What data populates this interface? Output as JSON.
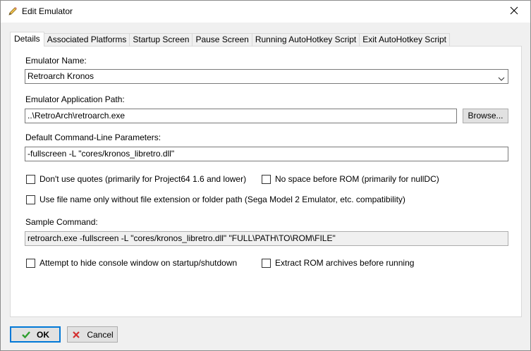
{
  "window": {
    "title": "Edit Emulator",
    "title_icon": "pencil-icon",
    "close_icon": "close-icon"
  },
  "tabs": [
    {
      "label": "Details",
      "active": true
    },
    {
      "label": "Associated Platforms",
      "active": false
    },
    {
      "label": "Startup Screen",
      "active": false
    },
    {
      "label": "Pause Screen",
      "active": false
    },
    {
      "label": "Running AutoHotkey Script",
      "active": false
    },
    {
      "label": "Exit AutoHotkey Script",
      "active": false
    }
  ],
  "details": {
    "emulator_name_label": "Emulator Name:",
    "emulator_name_value": "Retroarch Kronos",
    "app_path_label": "Emulator Application Path:",
    "app_path_value": "..\\RetroArch\\retroarch.exe",
    "browse_label": "Browse...",
    "params_label": "Default Command-Line Parameters:",
    "params_value": "-fullscreen -L  \"cores/kronos_libretro.dll\"",
    "chk_no_quotes": {
      "label": "Don't use quotes (primarily for Project64 1.6 and lower)",
      "checked": false
    },
    "chk_no_space": {
      "label": "No space before ROM (primarily for nullDC)",
      "checked": false
    },
    "chk_filename_only": {
      "label": "Use file name only without file extension or folder path (Sega Model 2 Emulator, etc. compatibility)",
      "checked": false
    },
    "sample_label": "Sample Command:",
    "sample_value": "retroarch.exe -fullscreen -L  \"cores/kronos_libretro.dll\" \"FULL\\PATH\\TO\\ROM\\FILE\"",
    "chk_hide_console": {
      "label": "Attempt to hide console window on startup/shutdown",
      "checked": false
    },
    "chk_extract": {
      "label": "Extract ROM archives before running",
      "checked": false
    }
  },
  "buttons": {
    "ok_label": "OK",
    "ok_icon": "checkmark-icon",
    "cancel_label": "Cancel",
    "cancel_icon": "x-icon"
  },
  "colors": {
    "accent": "#0078d7",
    "ok_check": "#2e9e2e",
    "cancel_x": "#d32f2f"
  }
}
